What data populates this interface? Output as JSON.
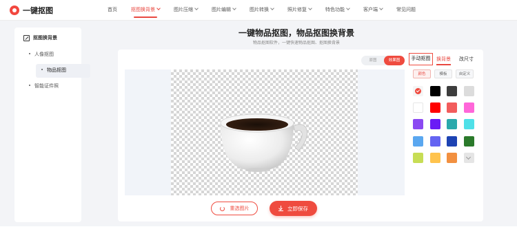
{
  "brand": {
    "name": "一键抠图",
    "accent": "#ef4b3f"
  },
  "nav": {
    "items": [
      {
        "label": "首页",
        "has_dropdown": false,
        "active": false
      },
      {
        "label": "抠图换背景",
        "has_dropdown": true,
        "active": true
      },
      {
        "label": "图片压缩",
        "has_dropdown": true,
        "active": false
      },
      {
        "label": "图片编辑",
        "has_dropdown": true,
        "active": false
      },
      {
        "label": "图片转换",
        "has_dropdown": true,
        "active": false
      },
      {
        "label": "照片修复",
        "has_dropdown": true,
        "active": false
      },
      {
        "label": "特色功能",
        "has_dropdown": true,
        "active": false
      },
      {
        "label": "客户端",
        "has_dropdown": true,
        "active": false
      },
      {
        "label": "常见问题",
        "has_dropdown": false,
        "active": false
      }
    ]
  },
  "sidebar": {
    "header": "抠图换背景",
    "items": [
      {
        "label": "人像抠图",
        "active": false
      },
      {
        "label": "物品抠图",
        "active": true
      },
      {
        "label": "智能证件照",
        "active": false
      }
    ]
  },
  "page": {
    "title": "一键物品抠图，物品抠图换背景",
    "subtitle": "物品抠图软件，一键快速物品抠图、抠图换背景"
  },
  "view_toggle": {
    "original": "原图",
    "result": "效果图",
    "selected": "效果图"
  },
  "editor": {
    "image": "white-coffee-cup",
    "background": "transparent"
  },
  "actions": {
    "reselect_label": "重选图片",
    "save_label": "立即保存"
  },
  "right_panel": {
    "tabs": [
      "手动抠图",
      "换背景",
      "改尺寸"
    ],
    "active_tab": "换背景",
    "subtabs": [
      "颜色",
      "模板",
      "自定义"
    ],
    "active_subtab": "颜色",
    "swatches": [
      [
        "#ffffff",
        "#000000",
        "#3d3d3d",
        "#dcdcdc"
      ],
      [
        "#ffffff",
        "#ff0000",
        "#f25c5c",
        "#ff66d9"
      ],
      [
        "#8b49f2",
        "#6a1cf5",
        "#2aa9ac",
        "#4fe0e8"
      ],
      [
        "#5aa7f0",
        "#6464f2",
        "#1d43b3",
        "#2b7a2b"
      ],
      [
        "#c7dd55",
        "#ffc34d",
        "#f29040",
        "#e5e5e5"
      ]
    ],
    "selected_swatch": "transparent",
    "more_icon": "chevron-down-icon"
  }
}
